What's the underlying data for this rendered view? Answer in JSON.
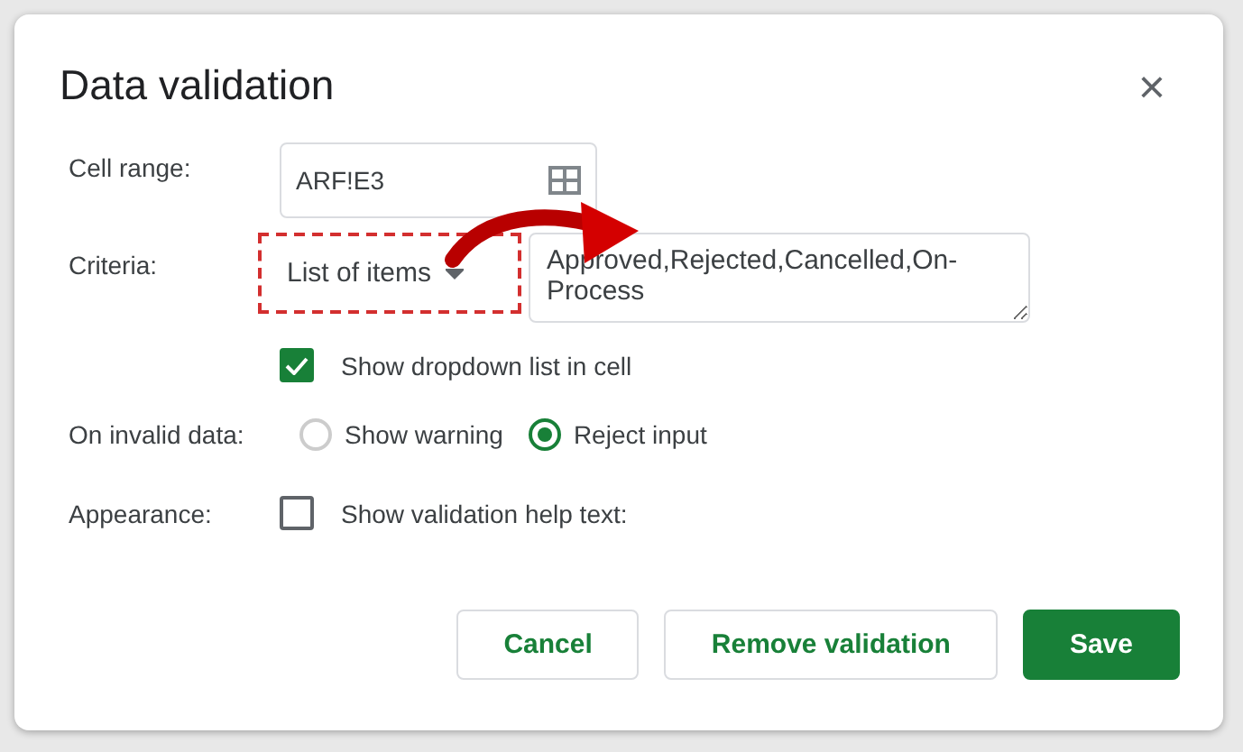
{
  "dialog": {
    "title": "Data validation",
    "close": "×"
  },
  "cell_range": {
    "label": "Cell range:",
    "value": "ARF!E3"
  },
  "criteria": {
    "label": "Criteria:",
    "type": "List of items",
    "items": "Approved,Rejected,Cancelled,On-Process",
    "highlighted": true
  },
  "show_dropdown": {
    "label": "Show dropdown list in cell",
    "checked": true
  },
  "invalid_data": {
    "label": "On invalid data:",
    "options": [
      {
        "label": "Show warning",
        "selected": false
      },
      {
        "label": "Reject input",
        "selected": true
      }
    ]
  },
  "appearance": {
    "label": "Appearance:",
    "help_text": {
      "label": "Show validation help text:",
      "checked": false
    }
  },
  "buttons": [
    {
      "label": "Cancel",
      "kind": "secondary"
    },
    {
      "label": "Remove validation",
      "kind": "secondary"
    },
    {
      "label": "Save",
      "kind": "primary"
    }
  ]
}
